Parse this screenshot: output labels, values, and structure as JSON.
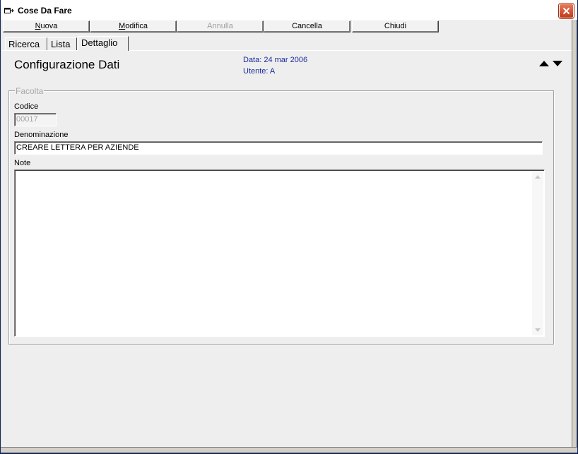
{
  "window": {
    "title": "Cose Da Fare"
  },
  "toolbar": {
    "buttons": [
      {
        "label": "Nuova",
        "accel": "N",
        "rest": "uova",
        "enabled": true
      },
      {
        "label": "Modifica",
        "accel": "M",
        "rest": "odifica",
        "enabled": true
      },
      {
        "label": "Annulla",
        "enabled": false
      },
      {
        "label": "Cancella",
        "enabled": true
      },
      {
        "label": "Chiudi",
        "enabled": true
      }
    ]
  },
  "tabs": [
    {
      "label": "Ricerca",
      "active": false
    },
    {
      "label": "Lista",
      "active": false
    },
    {
      "label": "Dettaglio",
      "active": true
    }
  ],
  "header": {
    "title": "Configurazione Dati",
    "date": "Data: 24 mar 2006",
    "user": "Utente: A"
  },
  "group": {
    "legend": "Facolta",
    "codice_label": "Codice",
    "codice_value": "00017",
    "denominazione_label": "Denominazione",
    "denominazione_value": "CREARE LETTERA PER AZIENDE",
    "note_label": "Note",
    "note_value": ""
  },
  "icons": {
    "window": "window-app-icon",
    "close": "close-icon",
    "prev": "up-arrow-icon",
    "next": "down-arrow-icon"
  },
  "colors": {
    "info_text": "#1a2a9a",
    "close_button": "#c0391b",
    "disabled_text": "#a0a0a0"
  }
}
